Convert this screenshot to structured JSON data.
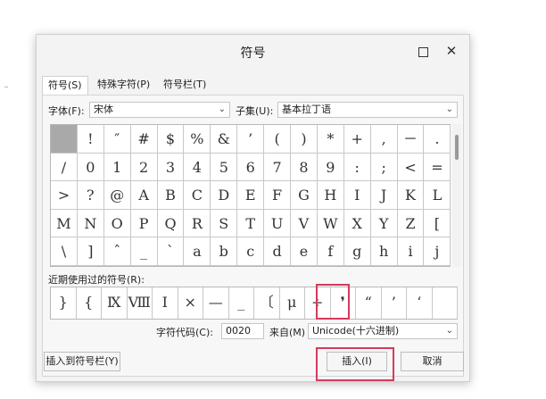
{
  "dialog": {
    "title": "符号",
    "tabs": [
      "符号(S)",
      "特殊字符(P)",
      "符号栏(T)"
    ],
    "font_label": "字体(F):",
    "font_value": "宋体",
    "subset_label": "子集(U):",
    "subset_value": "基本拉丁语",
    "grid": [
      [
        "",
        "!",
        "″",
        "#",
        "$",
        "%",
        "&",
        "’",
        "(",
        ")",
        "*",
        "+",
        ",",
        "－",
        "."
      ],
      [
        "/",
        "0",
        "1",
        "2",
        "3",
        "4",
        "5",
        "6",
        "7",
        "8",
        "9",
        ":",
        ";",
        "<",
        "="
      ],
      [
        ">",
        "?",
        "@",
        "A",
        "B",
        "C",
        "D",
        "E",
        "F",
        "G",
        "H",
        "I",
        "J",
        "K",
        "L"
      ],
      [
        "M",
        "N",
        "O",
        "P",
        "Q",
        "R",
        "S",
        "T",
        "U",
        "V",
        "W",
        "X",
        "Y",
        "Z",
        "["
      ],
      [
        "\\",
        "]",
        "ˆ",
        "_",
        "`",
        "a",
        "b",
        "c",
        "d",
        "e",
        "f",
        "g",
        "h",
        "i",
        "j"
      ]
    ],
    "recent_label": "近期使用过的符号(R):",
    "recent": [
      "}",
      "{",
      "Ⅸ",
      "Ⅷ",
      "Ⅰ",
      "×",
      "—",
      "_",
      "〔",
      "μ",
      "÷",
      "❜",
      "“",
      "’",
      "‘",
      ""
    ],
    "char_code_label": "字符代码(C):",
    "char_code_value": "0020",
    "from_label": "来自(M)",
    "from_value": "Unicode(十六进制)",
    "insert_to_bar_button": "插入到符号栏(Y)",
    "insert_button": "插入(I)",
    "cancel_button": "取消"
  },
  "colors": {
    "highlight": "#d63a5a",
    "selected_cell": "#a9a9a9"
  }
}
